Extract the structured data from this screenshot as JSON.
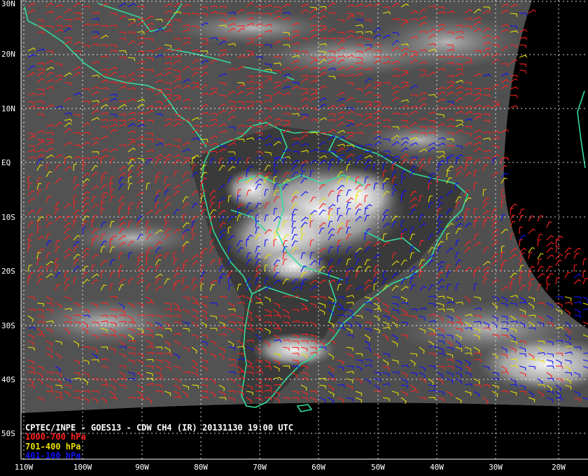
{
  "product": {
    "caption": "CPTEC/INPE - GOES13 - CDW CH4 (IR) 20131130 19:00 UTC"
  },
  "legend": [
    {
      "label": "1000-700 hPa",
      "color": "#ff2020"
    },
    {
      "label": "701-400 hPa",
      "color": "#e8e000"
    },
    {
      "label": "401-100 hPa",
      "color": "#1010ff"
    }
  ],
  "lat_labels": [
    "30N",
    "20N",
    "10N",
    "EQ",
    "10S",
    "20S",
    "30S",
    "40S",
    "50S"
  ],
  "lon_labels": [
    "110W",
    "100W",
    "90W",
    "80W",
    "70W",
    "60W",
    "50W",
    "40W",
    "30W",
    "20W"
  ],
  "colors": {
    "coastline": "#33dd99",
    "grid": "#ffffff",
    "background": "#000000"
  }
}
